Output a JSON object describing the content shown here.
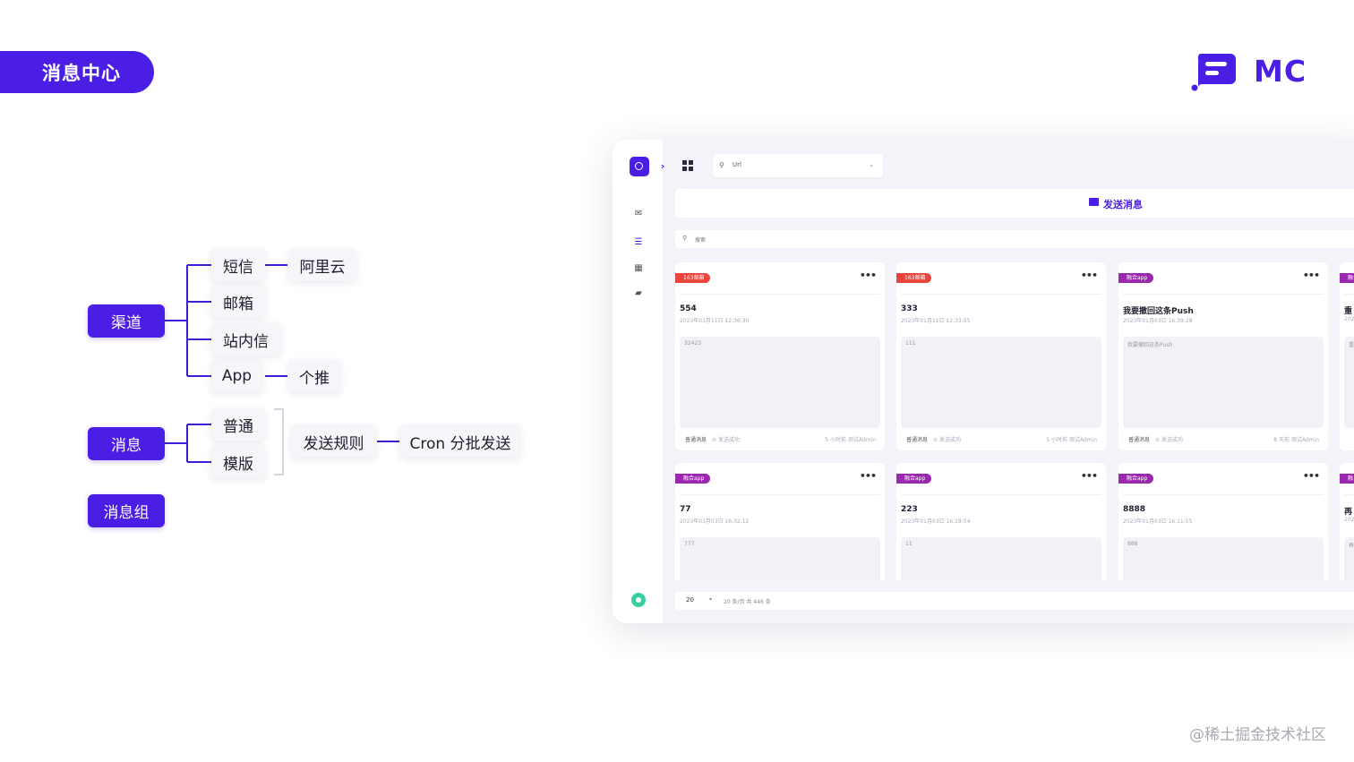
{
  "header": {
    "title": "消息中心"
  },
  "logo": {
    "text": "MC",
    "color": "#4b1ee6"
  },
  "mindmap": {
    "channel": {
      "label": "渠道",
      "children": [
        "短信",
        "邮箱",
        "站内信",
        "App"
      ]
    },
    "sms_provider": "阿里云",
    "app_provider": "个推",
    "message": {
      "label": "消息",
      "children": [
        "普通",
        "模版"
      ]
    },
    "send_rule": "发送规则",
    "cron": "Cron 分批发送",
    "message_group": "消息组"
  },
  "app": {
    "url_select": {
      "value": "Url"
    },
    "send_bar": {
      "label": "发送消息"
    },
    "search": {
      "placeholder": "搜索"
    },
    "cards": [
      {
        "tag": "163邮箱",
        "tag_color": "#e8453c",
        "title": "554",
        "time": "2023年01月11日 12:36:30",
        "content": "32423",
        "type": "普通消息",
        "status": "发送成功",
        "ago": "5 小时前",
        "user": "测试Admin"
      },
      {
        "tag": "163邮箱",
        "tag_color": "#e8453c",
        "title": "333",
        "time": "2023年01月11日 12:33:55",
        "content": "111",
        "type": "普通消息",
        "status": "发送成功",
        "ago": "5 小时前",
        "user": "测试Admin"
      },
      {
        "tag": "融合app",
        "tag_color": "#9c27b0",
        "title": "我要撤回这条Push",
        "time": "2023年01月03日 16:39:28",
        "content": "我要撤回这条Push",
        "type": "普通消息",
        "status": "发送成功",
        "ago": "8 天前",
        "user": "测试Admin"
      },
      {
        "tag": "融合app",
        "tag_color": "#9c27b0",
        "title": "重",
        "time": "202",
        "content": "重"
      },
      {
        "tag": "融合app",
        "tag_color": "#9c27b0",
        "title": "77",
        "time": "2023年01月03日 16:32:12",
        "content": "777"
      },
      {
        "tag": "融合app",
        "tag_color": "#9c27b0",
        "title": "223",
        "time": "2023年01月03日 16:19:54",
        "content": "11"
      },
      {
        "tag": "融合app",
        "tag_color": "#9c27b0",
        "title": "8888",
        "time": "2023年01月03日 16:11:55",
        "content": "888"
      },
      {
        "tag": "融",
        "tag_color": "#9c27b0",
        "title": "再",
        "time": "202",
        "content": "再"
      }
    ],
    "pager": {
      "page_size": "20",
      "total": "20 条/页  共 446 条"
    }
  },
  "watermark": "@稀土掘金技术社区"
}
